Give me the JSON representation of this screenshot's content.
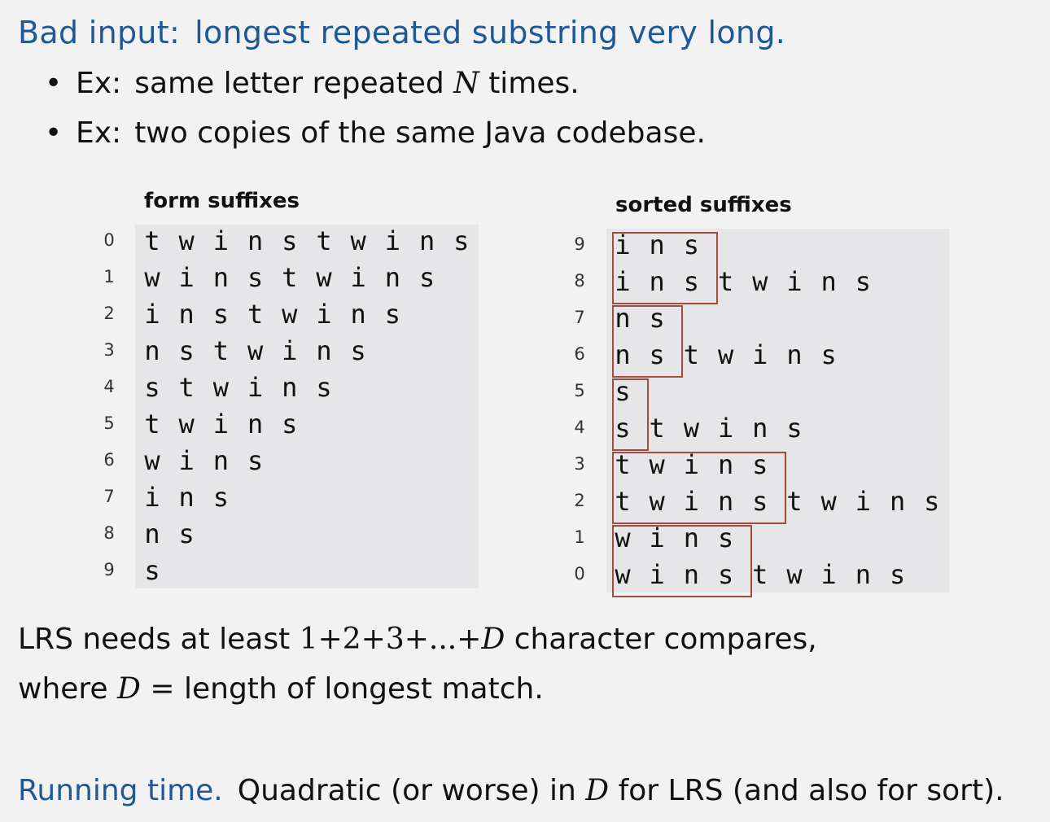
{
  "heading": {
    "label": "Bad input:",
    "text": "longest repeated substring very long."
  },
  "bullets": [
    {
      "prefix": "Ex:",
      "before": "same letter repeated",
      "math": "N",
      "after": "times."
    },
    {
      "prefix": "Ex:",
      "text": "two copies of the same Java codebase."
    }
  ],
  "form_suffixes": {
    "title": "form suffixes",
    "rows": [
      {
        "index": "0",
        "chars": [
          "t",
          "w",
          "i",
          "n",
          "s",
          "t",
          "w",
          "i",
          "n",
          "s"
        ]
      },
      {
        "index": "1",
        "chars": [
          "w",
          "i",
          "n",
          "s",
          "t",
          "w",
          "i",
          "n",
          "s"
        ]
      },
      {
        "index": "2",
        "chars": [
          "i",
          "n",
          "s",
          "t",
          "w",
          "i",
          "n",
          "s"
        ]
      },
      {
        "index": "3",
        "chars": [
          "n",
          "s",
          "t",
          "w",
          "i",
          "n",
          "s"
        ]
      },
      {
        "index": "4",
        "chars": [
          "s",
          "t",
          "w",
          "i",
          "n",
          "s"
        ]
      },
      {
        "index": "5",
        "chars": [
          "t",
          "w",
          "i",
          "n",
          "s"
        ]
      },
      {
        "index": "6",
        "chars": [
          "w",
          "i",
          "n",
          "s"
        ]
      },
      {
        "index": "7",
        "chars": [
          "i",
          "n",
          "s"
        ]
      },
      {
        "index": "8",
        "chars": [
          "n",
          "s"
        ]
      },
      {
        "index": "9",
        "chars": [
          "s"
        ]
      }
    ]
  },
  "sorted_suffixes": {
    "title": "sorted suffixes",
    "rows": [
      {
        "index": "9",
        "chars": [
          "i",
          "n",
          "s"
        ]
      },
      {
        "index": "8",
        "chars": [
          "i",
          "n",
          "s",
          "t",
          "w",
          "i",
          "n",
          "s"
        ]
      },
      {
        "index": "7",
        "chars": [
          "n",
          "s"
        ]
      },
      {
        "index": "6",
        "chars": [
          "n",
          "s",
          "t",
          "w",
          "i",
          "n",
          "s"
        ]
      },
      {
        "index": "5",
        "chars": [
          "s"
        ]
      },
      {
        "index": "4",
        "chars": [
          "s",
          "t",
          "w",
          "i",
          "n",
          "s"
        ]
      },
      {
        "index": "3",
        "chars": [
          "t",
          "w",
          "i",
          "n",
          "s"
        ]
      },
      {
        "index": "2",
        "chars": [
          "t",
          "w",
          "i",
          "n",
          "s",
          "t",
          "w",
          "i",
          "n",
          "s"
        ]
      },
      {
        "index": "1",
        "chars": [
          "w",
          "i",
          "n",
          "s"
        ]
      },
      {
        "index": "0",
        "chars": [
          "w",
          "i",
          "n",
          "s",
          "t",
          "w",
          "i",
          "n",
          "s"
        ]
      }
    ],
    "match_groups": [
      {
        "first_row": 0,
        "rows": 2,
        "length": 3
      },
      {
        "first_row": 2,
        "rows": 2,
        "length": 2
      },
      {
        "first_row": 4,
        "rows": 2,
        "length": 1
      },
      {
        "first_row": 6,
        "rows": 2,
        "length": 5
      },
      {
        "first_row": 8,
        "rows": 2,
        "length": 4
      }
    ]
  },
  "lrs": {
    "before": "LRS needs at least",
    "formula_1": "1",
    "plus": "+",
    "formula_2": "2",
    "formula_3": "3",
    "ellipsis": "...",
    "formula_D": "D",
    "after": "character compares,",
    "line2_before": "where",
    "line2_D": "D",
    "line2_eq": "=",
    "line2_after": "length of longest match."
  },
  "running": {
    "label": "Running time.",
    "before": "Quadratic (or worse) in",
    "math": "D",
    "after": "for LRS (and also for sort)."
  }
}
